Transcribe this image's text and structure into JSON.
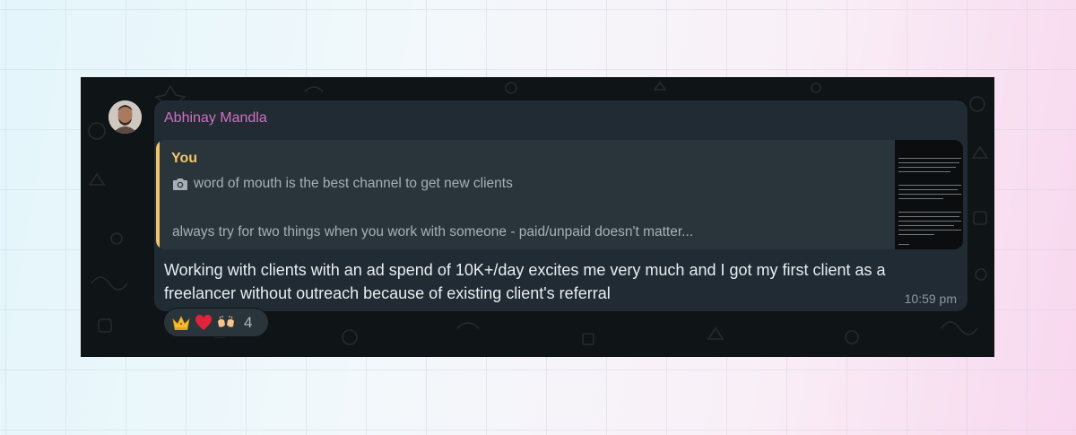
{
  "message": {
    "sender_name": "Abhinay Mandla",
    "reply": {
      "author": "You",
      "icon": "camera-icon",
      "line1": "word of mouth is the best channel to get new clients",
      "line2": "always try for two things when you work with someone - paid/unpaid doesn't matter..."
    },
    "body": "Working with clients with an ad spend of 10K+/day excites me very much and I got my first client as a freelancer without outreach because of existing client's referral",
    "timestamp": "10:59 pm",
    "reactions": {
      "emojis": [
        "crown-emoji",
        "red-heart-emoji",
        "raised-hands-emoji"
      ],
      "count": "4"
    }
  },
  "colors": {
    "sender": "#d36fc1",
    "quote_accent": "#f1c56b",
    "bubble": "#202b33",
    "panel": "#0f1417"
  }
}
